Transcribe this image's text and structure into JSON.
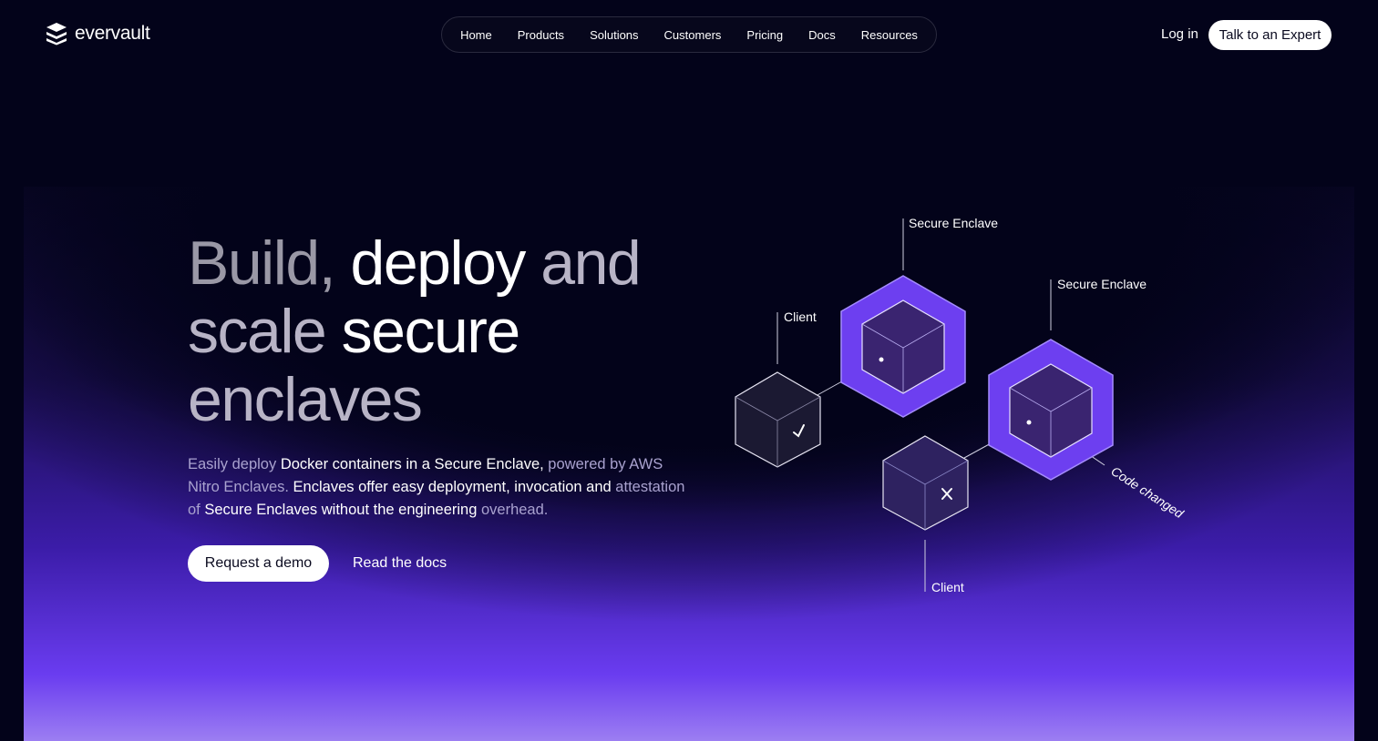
{
  "brand": {
    "name": "evervault",
    "logo_icon": "evervault-stack-icon"
  },
  "nav": {
    "items": [
      {
        "label": "Home"
      },
      {
        "label": "Products"
      },
      {
        "label": "Solutions"
      },
      {
        "label": "Customers"
      },
      {
        "label": "Pricing"
      },
      {
        "label": "Docs"
      },
      {
        "label": "Resources"
      }
    ]
  },
  "header": {
    "login_label": "Log in",
    "expert_label": "Talk to an Expert"
  },
  "hero": {
    "headline": {
      "part1": "Build, ",
      "part2": "deploy",
      "part3": " and",
      "part4": "scale ",
      "part5": "secure",
      "part6": "enclaves"
    },
    "subtitle": {
      "s1": "Easily deploy ",
      "s2": "Docker containers in a Secure Enclave,",
      "s3": " powered by AWS Nitro Enclaves. ",
      "s4": "Enclaves offer easy deployment, invocation and",
      "s5": " attestation of ",
      "s6": "Secure Enclaves without the engineering",
      "s7": " overhead."
    },
    "demo_label": "Request a demo",
    "docs_label": "Read the docs"
  },
  "diagram": {
    "label_enclave_1": "Secure Enclave",
    "label_enclave_2": "Secure Enclave",
    "label_client_1": "Client",
    "label_client_2": "Client",
    "label_code_changed": "Code changed",
    "icons": [
      "check-icon",
      "cross-icon"
    ],
    "colors": {
      "accent": "#6a3cf0",
      "enclave_ring": "#6d3ff0"
    }
  }
}
